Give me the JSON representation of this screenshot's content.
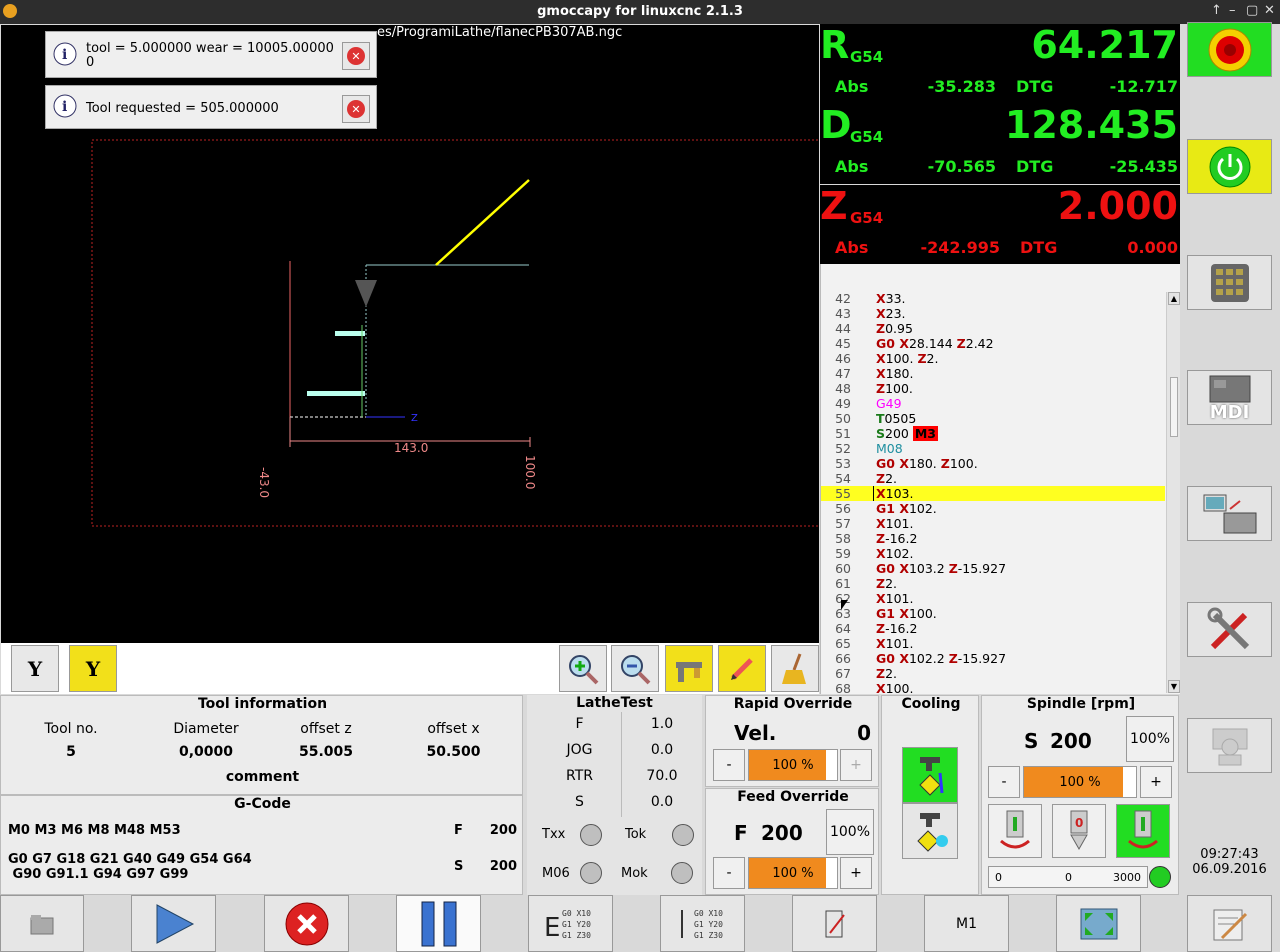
{
  "window": {
    "title": "gmoccapy for linuxcnc  2.1.3"
  },
  "preview": {
    "file_path": "es/ProgramiLathe/flanecPB307AB.ngc",
    "dim_width": "143.0",
    "dim_left": "-43.0",
    "dim_right": "100.0"
  },
  "notifications": [
    {
      "message": "tool = 5.000000 wear = 10005.00000 0"
    },
    {
      "message": "Tool requested = 505.000000"
    }
  ],
  "dro": {
    "r": {
      "axis": "R",
      "coord": "G54",
      "value": "64.217",
      "abs_label": "Abs",
      "abs": "-35.283",
      "dtg_label": "DTG",
      "dtg": "-12.717",
      "color": "#22ee22"
    },
    "d": {
      "axis": "D",
      "coord": "G54",
      "value": "128.435",
      "abs_label": "Abs",
      "abs": "-70.565",
      "dtg_label": "DTG",
      "dtg": "-25.435",
      "color": "#22ee22"
    },
    "z": {
      "axis": "Z",
      "coord": "G54",
      "value": "2.000",
      "abs_label": "Abs",
      "abs": "-242.995",
      "dtg_label": "DTG",
      "dtg": "0.000",
      "color": "#ee1111"
    }
  },
  "gcode": {
    "highlight_line": "55",
    "lines": [
      {
        "n": "42",
        "w": [
          {
            "t": "X",
            "c": "d"
          },
          {
            "t": "33."
          }
        ]
      },
      {
        "n": "43",
        "w": [
          {
            "t": "X",
            "c": "d"
          },
          {
            "t": "23."
          }
        ]
      },
      {
        "n": "44",
        "w": [
          {
            "t": "Z",
            "c": "d"
          },
          {
            "t": "0.95"
          }
        ]
      },
      {
        "n": "45",
        "w": [
          {
            "t": "G0 ",
            "c": "d"
          },
          {
            "t": "X",
            "c": "d"
          },
          {
            "t": "28.144 "
          },
          {
            "t": "Z",
            "c": "d"
          },
          {
            "t": "2.42"
          }
        ]
      },
      {
        "n": "46",
        "w": [
          {
            "t": "X",
            "c": "d"
          },
          {
            "t": "100. "
          },
          {
            "t": "Z",
            "c": "d"
          },
          {
            "t": "2."
          }
        ]
      },
      {
        "n": "47",
        "w": [
          {
            "t": "X",
            "c": "d"
          },
          {
            "t": "180."
          }
        ]
      },
      {
        "n": "48",
        "w": [
          {
            "t": "Z",
            "c": "d"
          },
          {
            "t": "100."
          }
        ]
      },
      {
        "n": "49",
        "w": [
          {
            "t": "G49",
            "c": "m"
          }
        ]
      },
      {
        "n": "50",
        "w": [
          {
            "t": "T",
            "c": "t"
          },
          {
            "t": "0505"
          }
        ]
      },
      {
        "n": "51",
        "w": [
          {
            "t": "S",
            "c": "t"
          },
          {
            "t": "200 "
          },
          {
            "t": "M3",
            "c": "b"
          }
        ]
      },
      {
        "n": "52",
        "w": [
          {
            "t": "M08",
            "c": "c"
          }
        ]
      },
      {
        "n": "53",
        "w": [
          {
            "t": "G0 ",
            "c": "d"
          },
          {
            "t": "X",
            "c": "d"
          },
          {
            "t": "180. "
          },
          {
            "t": "Z",
            "c": "d"
          },
          {
            "t": "100."
          }
        ]
      },
      {
        "n": "54",
        "w": [
          {
            "t": "Z",
            "c": "d"
          },
          {
            "t": "2."
          }
        ]
      },
      {
        "n": "55",
        "w": [
          {
            "t": "X",
            "c": "d"
          },
          {
            "t": "103."
          }
        ]
      },
      {
        "n": "56",
        "w": [
          {
            "t": "G1 ",
            "c": "d"
          },
          {
            "t": "X",
            "c": "d"
          },
          {
            "t": "102."
          }
        ]
      },
      {
        "n": "57",
        "w": [
          {
            "t": "X",
            "c": "d"
          },
          {
            "t": "101."
          }
        ]
      },
      {
        "n": "58",
        "w": [
          {
            "t": "Z",
            "c": "d"
          },
          {
            "t": "-16.2"
          }
        ]
      },
      {
        "n": "59",
        "w": [
          {
            "t": "X",
            "c": "d"
          },
          {
            "t": "102."
          }
        ]
      },
      {
        "n": "60",
        "w": [
          {
            "t": "G0 ",
            "c": "d"
          },
          {
            "t": "X",
            "c": "d"
          },
          {
            "t": "103.2 "
          },
          {
            "t": "Z",
            "c": "d"
          },
          {
            "t": "-15.927"
          }
        ]
      },
      {
        "n": "61",
        "w": [
          {
            "t": "Z",
            "c": "d"
          },
          {
            "t": "2."
          }
        ]
      },
      {
        "n": "62",
        "w": [
          {
            "t": "X",
            "c": "d"
          },
          {
            "t": "101."
          }
        ]
      },
      {
        "n": "63",
        "w": [
          {
            "t": "G1 ",
            "c": "d"
          },
          {
            "t": "X",
            "c": "d"
          },
          {
            "t": "100."
          }
        ]
      },
      {
        "n": "64",
        "w": [
          {
            "t": "Z",
            "c": "d"
          },
          {
            "t": "-16.2"
          }
        ]
      },
      {
        "n": "65",
        "w": [
          {
            "t": "X",
            "c": "d"
          },
          {
            "t": "101."
          }
        ]
      },
      {
        "n": "66",
        "w": [
          {
            "t": "G0 ",
            "c": "d"
          },
          {
            "t": "X",
            "c": "d"
          },
          {
            "t": "102.2 "
          },
          {
            "t": "Z",
            "c": "d"
          },
          {
            "t": "-15.927"
          }
        ]
      },
      {
        "n": "67",
        "w": [
          {
            "t": "Z",
            "c": "d"
          },
          {
            "t": "2."
          }
        ]
      },
      {
        "n": "68",
        "w": [
          {
            "t": "X",
            "c": "d"
          },
          {
            "t": "100."
          }
        ]
      }
    ]
  },
  "side": {
    "mdi_label": "MDI"
  },
  "tool_info": {
    "title": "Tool information",
    "h_tool": "Tool no.",
    "h_diameter": "Diameter",
    "h_offz": "offset z",
    "h_offx": "offset x",
    "tool": "5",
    "diameter": "0,0000",
    "offz": "55.005",
    "offx": "50.500",
    "comment_label": "comment"
  },
  "gcode_panel": {
    "title": "G-Code",
    "mcodes": "M0 M3 M6 M8 M48 M53",
    "gcodes_1": "G0 G7 G18 G21 G40 G49 G54 G64",
    "gcodes_2": " G90 G91.1 G94 G97 G99",
    "f_label": "F",
    "f_value": "200",
    "s_label": "S",
    "s_value": "200"
  },
  "lathetest": {
    "title": "LatheTest",
    "rows": [
      {
        "k": "F",
        "v": "1.0"
      },
      {
        "k": "JOG",
        "v": "0.0"
      },
      {
        "k": "RTR",
        "v": "70.0"
      },
      {
        "k": "S",
        "v": "0.0"
      }
    ],
    "txx": "Txx",
    "tok": "Tok",
    "m06": "M06",
    "mok": "Mok"
  },
  "rapid": {
    "title": "Rapid Override",
    "vel_label": "Vel.",
    "vel_value": "0",
    "slider": "100 %",
    "percent": 100,
    "minus": "-",
    "plus": "+"
  },
  "feed": {
    "title": "Feed Override",
    "f_label": "F",
    "f_value": "200",
    "pct_button": "100%",
    "slider": "100 %",
    "percent": 100,
    "minus": "-",
    "plus": "+"
  },
  "cooling": {
    "title": "Cooling"
  },
  "spindle": {
    "title": "Spindle [rpm]",
    "s_label": "S",
    "s_value": "200",
    "pct_button": "100%",
    "slider": "100 %",
    "percent": 100,
    "minus": "-",
    "plus": "+",
    "bar_min": "0",
    "bar_val": "0",
    "bar_max": "3000"
  },
  "clock": {
    "time": "09:27:43",
    "date": "06.09.2016"
  },
  "bottom": {
    "m1_label": "M1"
  },
  "colors": {
    "accent_green": "#22ee22",
    "accent_orange": "#f08a1e",
    "highlight_yellow": "#ffff20"
  }
}
